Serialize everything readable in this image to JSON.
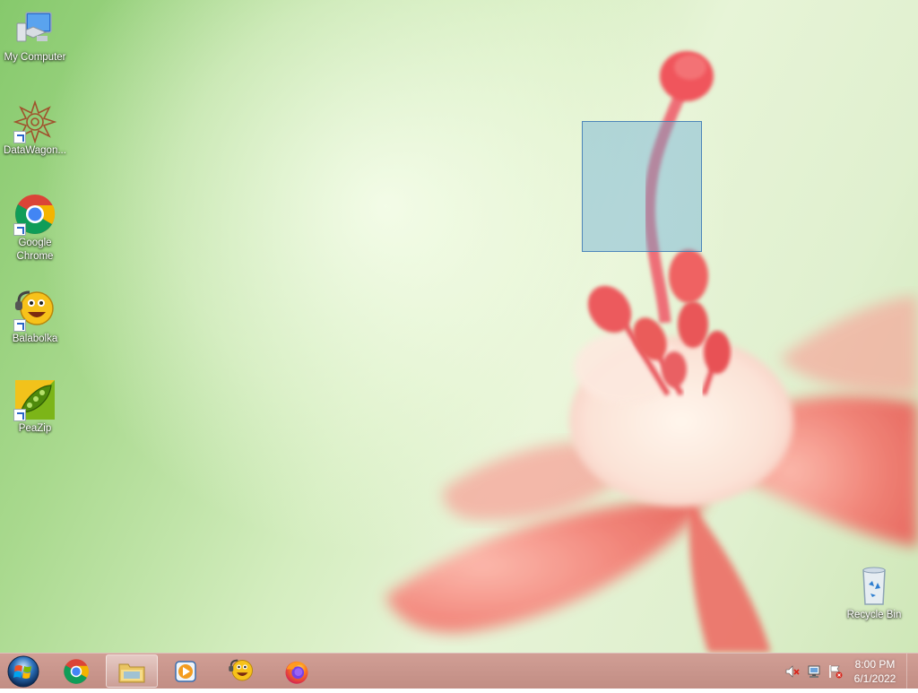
{
  "desktop": {
    "icons": [
      {
        "label": "My Computer",
        "icon": "computer-icon",
        "shortcut": false
      },
      {
        "label": "DataWagon...",
        "icon": "datawagon-icon",
        "shortcut": true
      },
      {
        "label": "Google Chrome",
        "icon": "chrome-icon",
        "shortcut": true
      },
      {
        "label": "Balabolka",
        "icon": "balabolka-icon",
        "shortcut": true
      },
      {
        "label": "PeaZip",
        "icon": "peazip-icon",
        "shortcut": true
      }
    ],
    "recycle_bin": {
      "label": "Recycle Bin",
      "icon": "recycle-bin-icon"
    }
  },
  "taskbar": {
    "start": {
      "icon": "windows-start-orb-icon"
    },
    "pinned": [
      {
        "name": "Google Chrome",
        "icon": "chrome-icon",
        "active": false
      },
      {
        "name": "Windows Explorer",
        "icon": "folder-icon",
        "active": true
      },
      {
        "name": "Windows Media Player",
        "icon": "media-player-icon",
        "active": false
      },
      {
        "name": "Balabolka",
        "icon": "balabolka-icon",
        "active": false
      },
      {
        "name": "Firefox",
        "icon": "firefox-icon",
        "active": false
      }
    ],
    "tray": {
      "icons": [
        "volume-muted-icon",
        "network-icon",
        "action-center-flag-icon"
      ],
      "time": "8:00 PM",
      "date": "6/1/2022"
    }
  },
  "colors": {
    "wallpaper_green": "#a9d98e",
    "flower_pink": "#f06f6a",
    "taskbar": "#c8918a",
    "selection": "#64aad7"
  }
}
